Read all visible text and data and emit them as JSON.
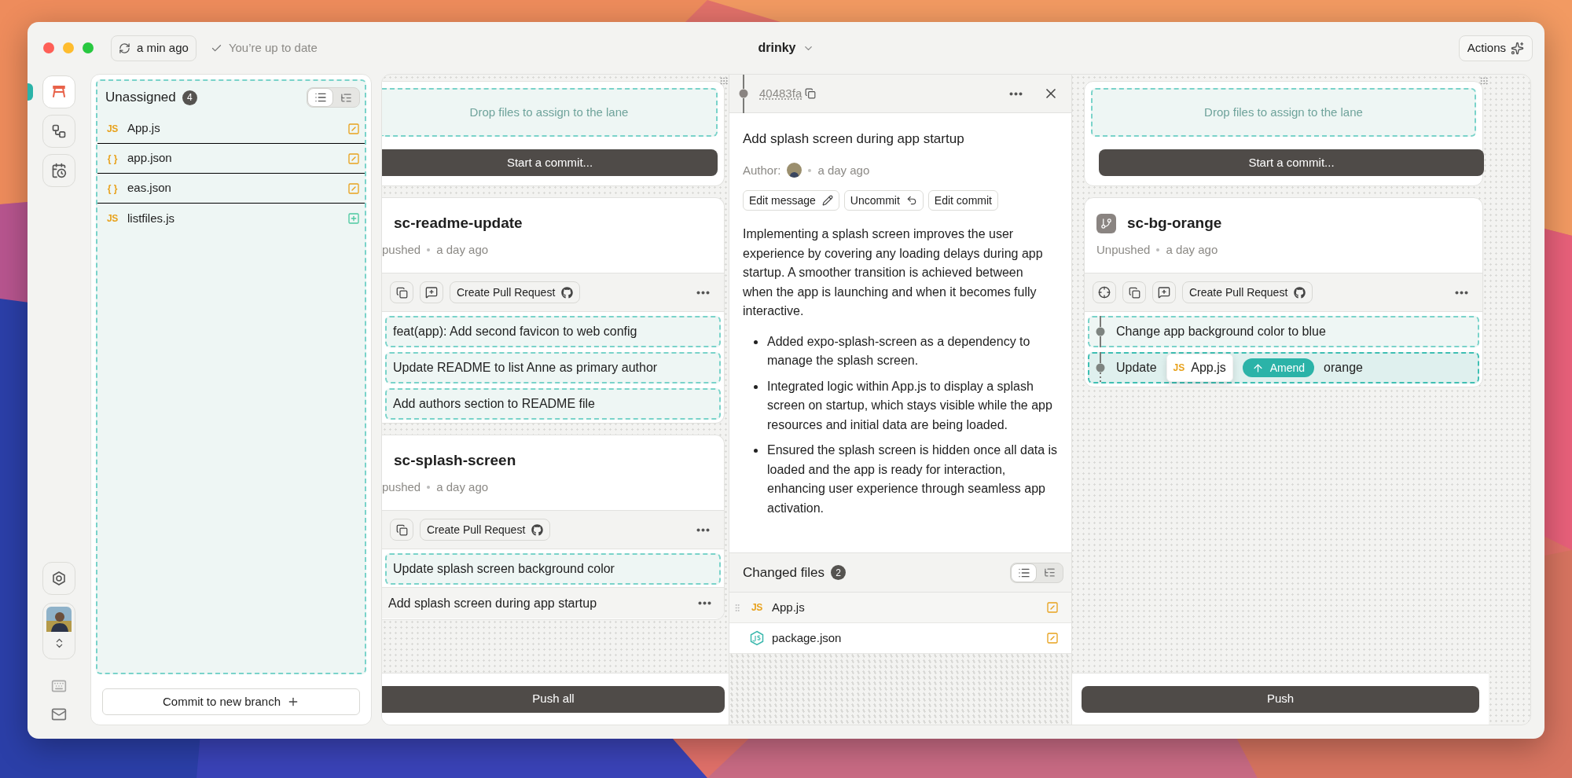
{
  "window": {
    "title": "drinky"
  },
  "toolbar": {
    "fetch_label": "a min ago",
    "status": "You’re up to date",
    "actions_label": "Actions"
  },
  "rail": {
    "items": [
      {
        "kind": "workspace",
        "selected": true
      },
      {
        "kind": "branches",
        "selected": false
      },
      {
        "kind": "history",
        "selected": false
      }
    ]
  },
  "unassigned": {
    "title": "Unassigned",
    "count": "4",
    "view_modes": [
      {
        "kind": "list",
        "selected": true
      },
      {
        "kind": "tree",
        "selected": false
      }
    ],
    "files": [
      {
        "name": "App.js",
        "kind": "js",
        "badge": "JS",
        "added": false
      },
      {
        "name": "app.json",
        "kind": "json",
        "badge": "{ }",
        "added": false
      },
      {
        "name": "eas.json",
        "kind": "json",
        "badge": "{ }",
        "added": false
      },
      {
        "name": "listfiles.js",
        "kind": "js",
        "badge": "JS",
        "added": true
      }
    ],
    "commit_button": "Commit to new branch"
  },
  "lanes": [
    {
      "clipped": true,
      "drop_hint": "Drop files to assign to the lane",
      "start_commit": "Start a commit...",
      "push_label": "Push all",
      "branches": [
        {
          "name": "sc-readme-update",
          "status": "pushed",
          "time": "a day ago",
          "tools": [
            {
              "kind": "copy"
            },
            {
              "kind": "review"
            }
          ],
          "pr_label": "Create Pull Request",
          "commits": [
            {
              "title": "feat(app): Add second favicon to web config",
              "selected": false,
              "drop_active": false
            },
            {
              "title": "Update README to list Anne as primary author",
              "selected": false,
              "drop_active": false
            },
            {
              "title": "Add authors section to README file",
              "selected": false,
              "drop_active": false
            }
          ]
        },
        {
          "name": "sc-splash-screen",
          "status": "pushed",
          "time": "a day ago",
          "tools": [
            {
              "kind": "copy"
            }
          ],
          "pr_label": "Create Pull Request",
          "commits": [
            {
              "title": "Update splash screen background color",
              "selected": false,
              "drop_active": false
            },
            {
              "title": "Add splash screen during app startup",
              "selected": true,
              "drop_active": false
            }
          ]
        }
      ]
    },
    {
      "clipped": false,
      "drop_hint": "Drop files to assign to the lane",
      "start_commit": "Start a commit...",
      "push_label": "Push",
      "branches": [
        {
          "name": "sc-bg-orange",
          "status": "Unpushed",
          "time": "a day ago",
          "tools": [
            {
              "kind": "target"
            },
            {
              "kind": "copy"
            },
            {
              "kind": "review"
            }
          ],
          "pr_label": "Create Pull Request",
          "commits": [
            {
              "title": "Change app background color to blue",
              "selected": false,
              "drop_active": false
            },
            {
              "title": "Update",
              "title_end": "orange",
              "selected": false,
              "drop_active": true,
              "drag_preview": {
                "badge": "JS",
                "name": "App.js"
              },
              "amend_label": "Amend"
            }
          ]
        }
      ]
    }
  ],
  "commit_details": {
    "hash": "40483fa",
    "title": "Add splash screen during app startup",
    "author_label": "Author:",
    "time": "a day ago",
    "actions": [
      {
        "label": "Edit message",
        "kind": "edit"
      },
      {
        "label": "Uncommit",
        "kind": "undo"
      },
      {
        "label": "Edit commit",
        "kind": "plain"
      }
    ],
    "description": "Implementing a splash screen improves the user experience by covering any loading delays during app startup. A smoother transition is achieved between when the app is launching and when it becomes fully interactive.",
    "bullets": [
      "Added expo-splash-screen as a dependency to manage the splash screen.",
      "Integrated logic within App.js to display a splash screen on startup, which stays visible while the app resources and initial data are being loaded.",
      "Ensured the splash screen is hidden once all data is loaded and the app is ready for interaction, enhancing user experience through seamless app activation."
    ],
    "changed_files": {
      "title": "Changed files",
      "count": "2",
      "view_modes": [
        {
          "kind": "list",
          "selected": true
        },
        {
          "kind": "tree",
          "selected": false
        }
      ],
      "files": [
        {
          "name": "App.js",
          "kind": "js",
          "badge": "JS",
          "added": false,
          "selected": true
        },
        {
          "name": "package.json",
          "kind": "node",
          "added": false,
          "selected": false
        }
      ]
    }
  }
}
